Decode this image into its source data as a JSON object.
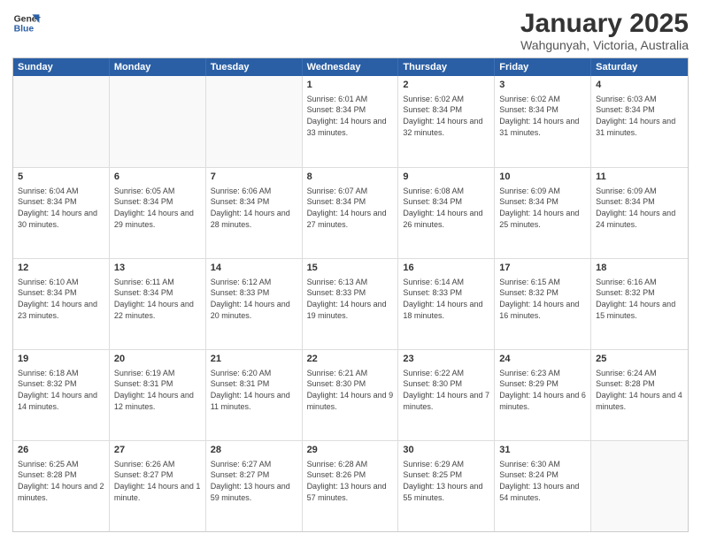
{
  "header": {
    "logo_line1": "General",
    "logo_line2": "Blue",
    "main_title": "January 2025",
    "subtitle": "Wahgunyah, Victoria, Australia"
  },
  "days_of_week": [
    "Sunday",
    "Monday",
    "Tuesday",
    "Wednesday",
    "Thursday",
    "Friday",
    "Saturday"
  ],
  "weeks": [
    [
      {
        "day": "",
        "empty": true
      },
      {
        "day": "",
        "empty": true
      },
      {
        "day": "",
        "empty": true
      },
      {
        "day": "1",
        "rise": "6:01 AM",
        "set": "8:34 PM",
        "daylight": "14 hours and 33 minutes."
      },
      {
        "day": "2",
        "rise": "6:02 AM",
        "set": "8:34 PM",
        "daylight": "14 hours and 32 minutes."
      },
      {
        "day": "3",
        "rise": "6:02 AM",
        "set": "8:34 PM",
        "daylight": "14 hours and 31 minutes."
      },
      {
        "day": "4",
        "rise": "6:03 AM",
        "set": "8:34 PM",
        "daylight": "14 hours and 31 minutes."
      }
    ],
    [
      {
        "day": "5",
        "rise": "6:04 AM",
        "set": "8:34 PM",
        "daylight": "14 hours and 30 minutes."
      },
      {
        "day": "6",
        "rise": "6:05 AM",
        "set": "8:34 PM",
        "daylight": "14 hours and 29 minutes."
      },
      {
        "day": "7",
        "rise": "6:06 AM",
        "set": "8:34 PM",
        "daylight": "14 hours and 28 minutes."
      },
      {
        "day": "8",
        "rise": "6:07 AM",
        "set": "8:34 PM",
        "daylight": "14 hours and 27 minutes."
      },
      {
        "day": "9",
        "rise": "6:08 AM",
        "set": "8:34 PM",
        "daylight": "14 hours and 26 minutes."
      },
      {
        "day": "10",
        "rise": "6:09 AM",
        "set": "8:34 PM",
        "daylight": "14 hours and 25 minutes."
      },
      {
        "day": "11",
        "rise": "6:09 AM",
        "set": "8:34 PM",
        "daylight": "14 hours and 24 minutes."
      }
    ],
    [
      {
        "day": "12",
        "rise": "6:10 AM",
        "set": "8:34 PM",
        "daylight": "14 hours and 23 minutes."
      },
      {
        "day": "13",
        "rise": "6:11 AM",
        "set": "8:34 PM",
        "daylight": "14 hours and 22 minutes."
      },
      {
        "day": "14",
        "rise": "6:12 AM",
        "set": "8:33 PM",
        "daylight": "14 hours and 20 minutes."
      },
      {
        "day": "15",
        "rise": "6:13 AM",
        "set": "8:33 PM",
        "daylight": "14 hours and 19 minutes."
      },
      {
        "day": "16",
        "rise": "6:14 AM",
        "set": "8:33 PM",
        "daylight": "14 hours and 18 minutes."
      },
      {
        "day": "17",
        "rise": "6:15 AM",
        "set": "8:32 PM",
        "daylight": "14 hours and 16 minutes."
      },
      {
        "day": "18",
        "rise": "6:16 AM",
        "set": "8:32 PM",
        "daylight": "14 hours and 15 minutes."
      }
    ],
    [
      {
        "day": "19",
        "rise": "6:18 AM",
        "set": "8:32 PM",
        "daylight": "14 hours and 14 minutes."
      },
      {
        "day": "20",
        "rise": "6:19 AM",
        "set": "8:31 PM",
        "daylight": "14 hours and 12 minutes."
      },
      {
        "day": "21",
        "rise": "6:20 AM",
        "set": "8:31 PM",
        "daylight": "14 hours and 11 minutes."
      },
      {
        "day": "22",
        "rise": "6:21 AM",
        "set": "8:30 PM",
        "daylight": "14 hours and 9 minutes."
      },
      {
        "day": "23",
        "rise": "6:22 AM",
        "set": "8:30 PM",
        "daylight": "14 hours and 7 minutes."
      },
      {
        "day": "24",
        "rise": "6:23 AM",
        "set": "8:29 PM",
        "daylight": "14 hours and 6 minutes."
      },
      {
        "day": "25",
        "rise": "6:24 AM",
        "set": "8:28 PM",
        "daylight": "14 hours and 4 minutes."
      }
    ],
    [
      {
        "day": "26",
        "rise": "6:25 AM",
        "set": "8:28 PM",
        "daylight": "14 hours and 2 minutes."
      },
      {
        "day": "27",
        "rise": "6:26 AM",
        "set": "8:27 PM",
        "daylight": "14 hours and 1 minute."
      },
      {
        "day": "28",
        "rise": "6:27 AM",
        "set": "8:27 PM",
        "daylight": "13 hours and 59 minutes."
      },
      {
        "day": "29",
        "rise": "6:28 AM",
        "set": "8:26 PM",
        "daylight": "13 hours and 57 minutes."
      },
      {
        "day": "30",
        "rise": "6:29 AM",
        "set": "8:25 PM",
        "daylight": "13 hours and 55 minutes."
      },
      {
        "day": "31",
        "rise": "6:30 AM",
        "set": "8:24 PM",
        "daylight": "13 hours and 54 minutes."
      },
      {
        "day": "",
        "empty": true
      }
    ]
  ]
}
